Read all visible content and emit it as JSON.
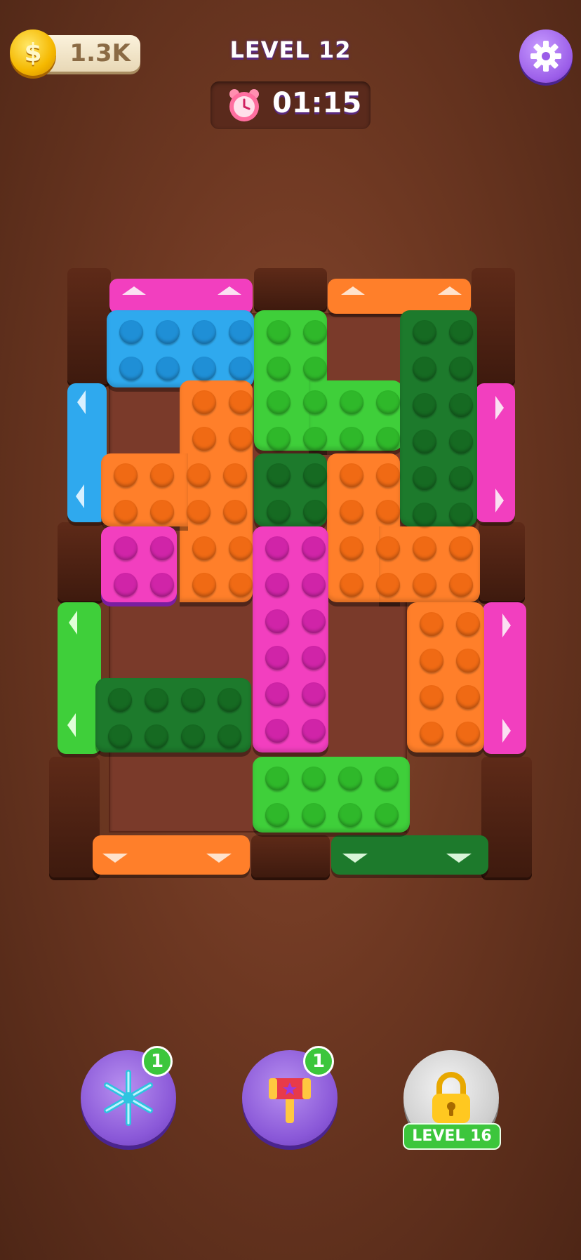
{
  "hud": {
    "coins": "1.3K",
    "coin_symbol": "$",
    "level": "LEVEL 12",
    "timer": "01:15"
  },
  "boosters": {
    "freeze": {
      "icon": "snowflake-icon",
      "count": "1"
    },
    "hammer": {
      "icon": "hammer-icon",
      "count": "1"
    },
    "locked": {
      "icon": "lock-icon",
      "label": "LEVEL 16"
    }
  },
  "colors": {
    "pink": "#f23fbf",
    "blue": "#2fa9ee",
    "orange": "#ff7f2a",
    "light_green": "#3fcf3a",
    "dark_green": "#1d7a2c",
    "wood": "#7a3a2a"
  }
}
